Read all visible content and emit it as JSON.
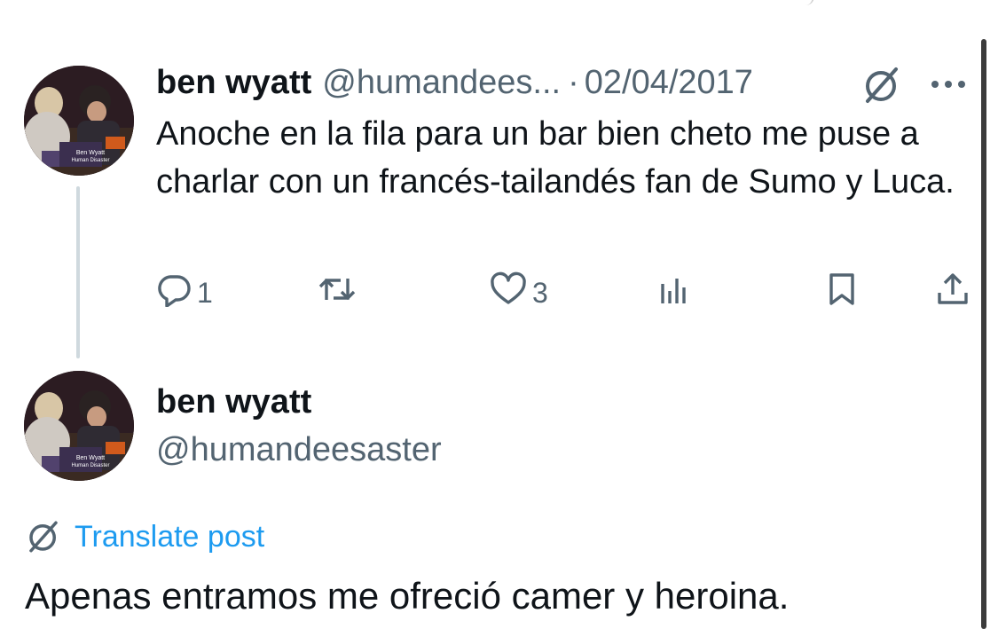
{
  "colors": {
    "text": "#0f1419",
    "muted": "#536471",
    "link": "#1d9bf0",
    "divider": "#cfd9de"
  },
  "reply_tweet": {
    "author_name": "ben wyatt",
    "author_handle": "@humandees...",
    "separator": "·",
    "date": "02/04/2017",
    "text": "Anoche en la fila para un bar bien cheto me puse a charlar con un francés-tailandés fan de Sumo y Luca.",
    "avatar_caption_line1": "Ben Wyatt",
    "avatar_caption_line2": "Human Disaster",
    "actions": {
      "reply_count": "1",
      "retweet_count": "",
      "like_count": "3",
      "view_count": ""
    },
    "icons": [
      "grok-icon",
      "more-icon",
      "reply-icon",
      "retweet-icon",
      "like-icon",
      "views-icon",
      "bookmark-icon",
      "share-icon"
    ]
  },
  "main_tweet": {
    "author_name": "ben wyatt",
    "author_handle": "@humandeesaster",
    "avatar_caption_line1": "Ben Wyatt",
    "avatar_caption_line2": "Human Disaster",
    "translate_label": "Translate post",
    "text": "Apenas entramos me ofreció camer y heroina."
  }
}
